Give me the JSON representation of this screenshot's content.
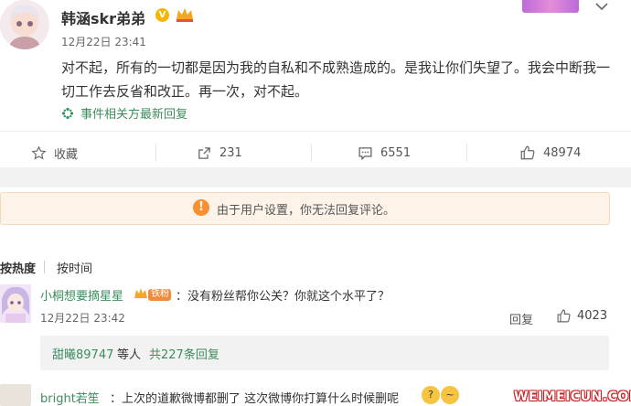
{
  "post": {
    "author": "韩涵skr弟弟",
    "time": "12月22日 23:41",
    "text": "对不起，所有的一切都是因为我的自私和不成熟造成的。是我让你们失望了。我会中断我一切工作去反省和改正。再一次，对不起。",
    "topic_link": "事件相关方最新回复",
    "verified_badge": "V"
  },
  "actions": {
    "favorite_label": "收藏",
    "share_count": "231",
    "comment_count": "6551",
    "like_count": "48974"
  },
  "notice": {
    "icon": "!",
    "text": "由于用户设置，你无法回复评论。"
  },
  "sort": {
    "hot_label": "按热度",
    "time_label": "按时间"
  },
  "comments": [
    {
      "user": "小桐想要摘星星",
      "badge_text": "铁粉",
      "text": "：没有粉丝帮你公关？你就这个水平了？",
      "time": "12月22日 23:42",
      "reply_label": "回复",
      "like_count": "4023",
      "replies": {
        "users": "甜曦89747",
        "others": "等人",
        "count_text": "共227条回复"
      }
    },
    {
      "user": "bright若笙",
      "text": "：上次的道歉微博都删了  这次微博你打算什么时候删呢"
    }
  ],
  "watermark": "WEIMEICUN.COM",
  "colors": {
    "accent_green": "#3c8c5d",
    "notice_orange": "#fa8f2f",
    "notice_bg": "#fdf3e8"
  }
}
